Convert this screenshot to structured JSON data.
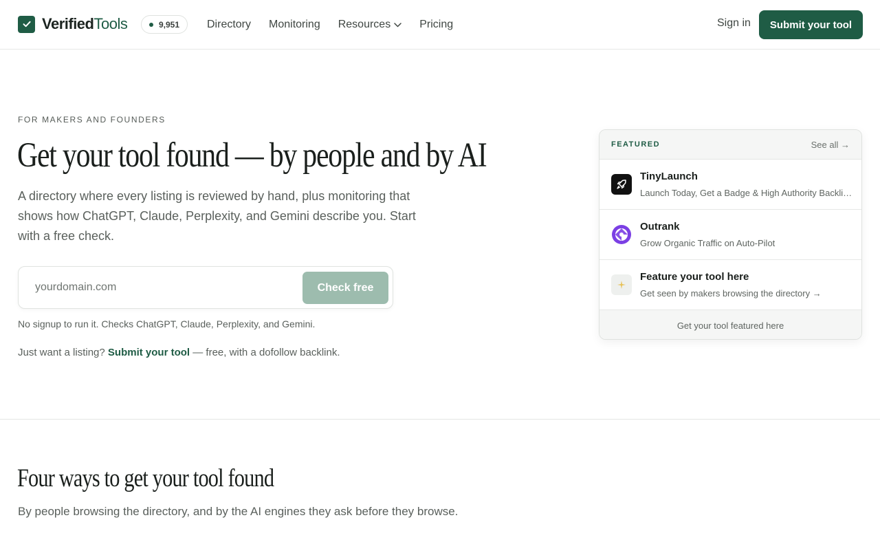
{
  "nav": {
    "logo_part1": "Verified",
    "logo_part2": "Tools",
    "count": "9,951",
    "links": [
      "Directory",
      "Monitoring",
      "Resources",
      "Pricing"
    ],
    "signin": "Sign in",
    "submit": "Submit your tool"
  },
  "hero": {
    "eyebrow": "FOR MAKERS AND FOUNDERS",
    "title": "Get your tool found — by people and by AI",
    "subtitle": "A directory where every listing is reviewed by hand, plus monitoring that shows how ChatGPT, Claude, Perplexity, and Gemini describe you. Start with a free check.",
    "input_placeholder": "yourdomain.com",
    "check_button": "Check free",
    "note": "No signup to run it. Checks ChatGPT, Claude, Perplexity, and Gemini.",
    "listing_prefix": "Just want a listing?",
    "listing_link": "Submit your tool",
    "listing_suffix": "— free, with a dofollow backlink."
  },
  "featured": {
    "label": "FEATURED",
    "see_all": "See all →",
    "items": [
      {
        "title": "TinyLaunch",
        "desc": "Launch Today, Get a Badge & High Authority Backlinks",
        "icon": "rocket-icon"
      },
      {
        "title": "Outrank",
        "desc": "Grow Organic Traffic on Auto-Pilot",
        "icon": "outrank-logo-icon"
      },
      {
        "title": "Feature your tool here",
        "desc": "Get seen by makers browsing the directory →",
        "icon": "sparkle-icon"
      }
    ],
    "footer": "Get your tool featured here"
  },
  "section2": {
    "title": "Four ways to get your tool found",
    "subtitle": "By people browsing the directory, and by the AI engines they ask before they browse."
  },
  "colors": {
    "brand": "#1f5c45",
    "button_disabled": "#9dbcae",
    "outrank": "#7b3fe4"
  }
}
